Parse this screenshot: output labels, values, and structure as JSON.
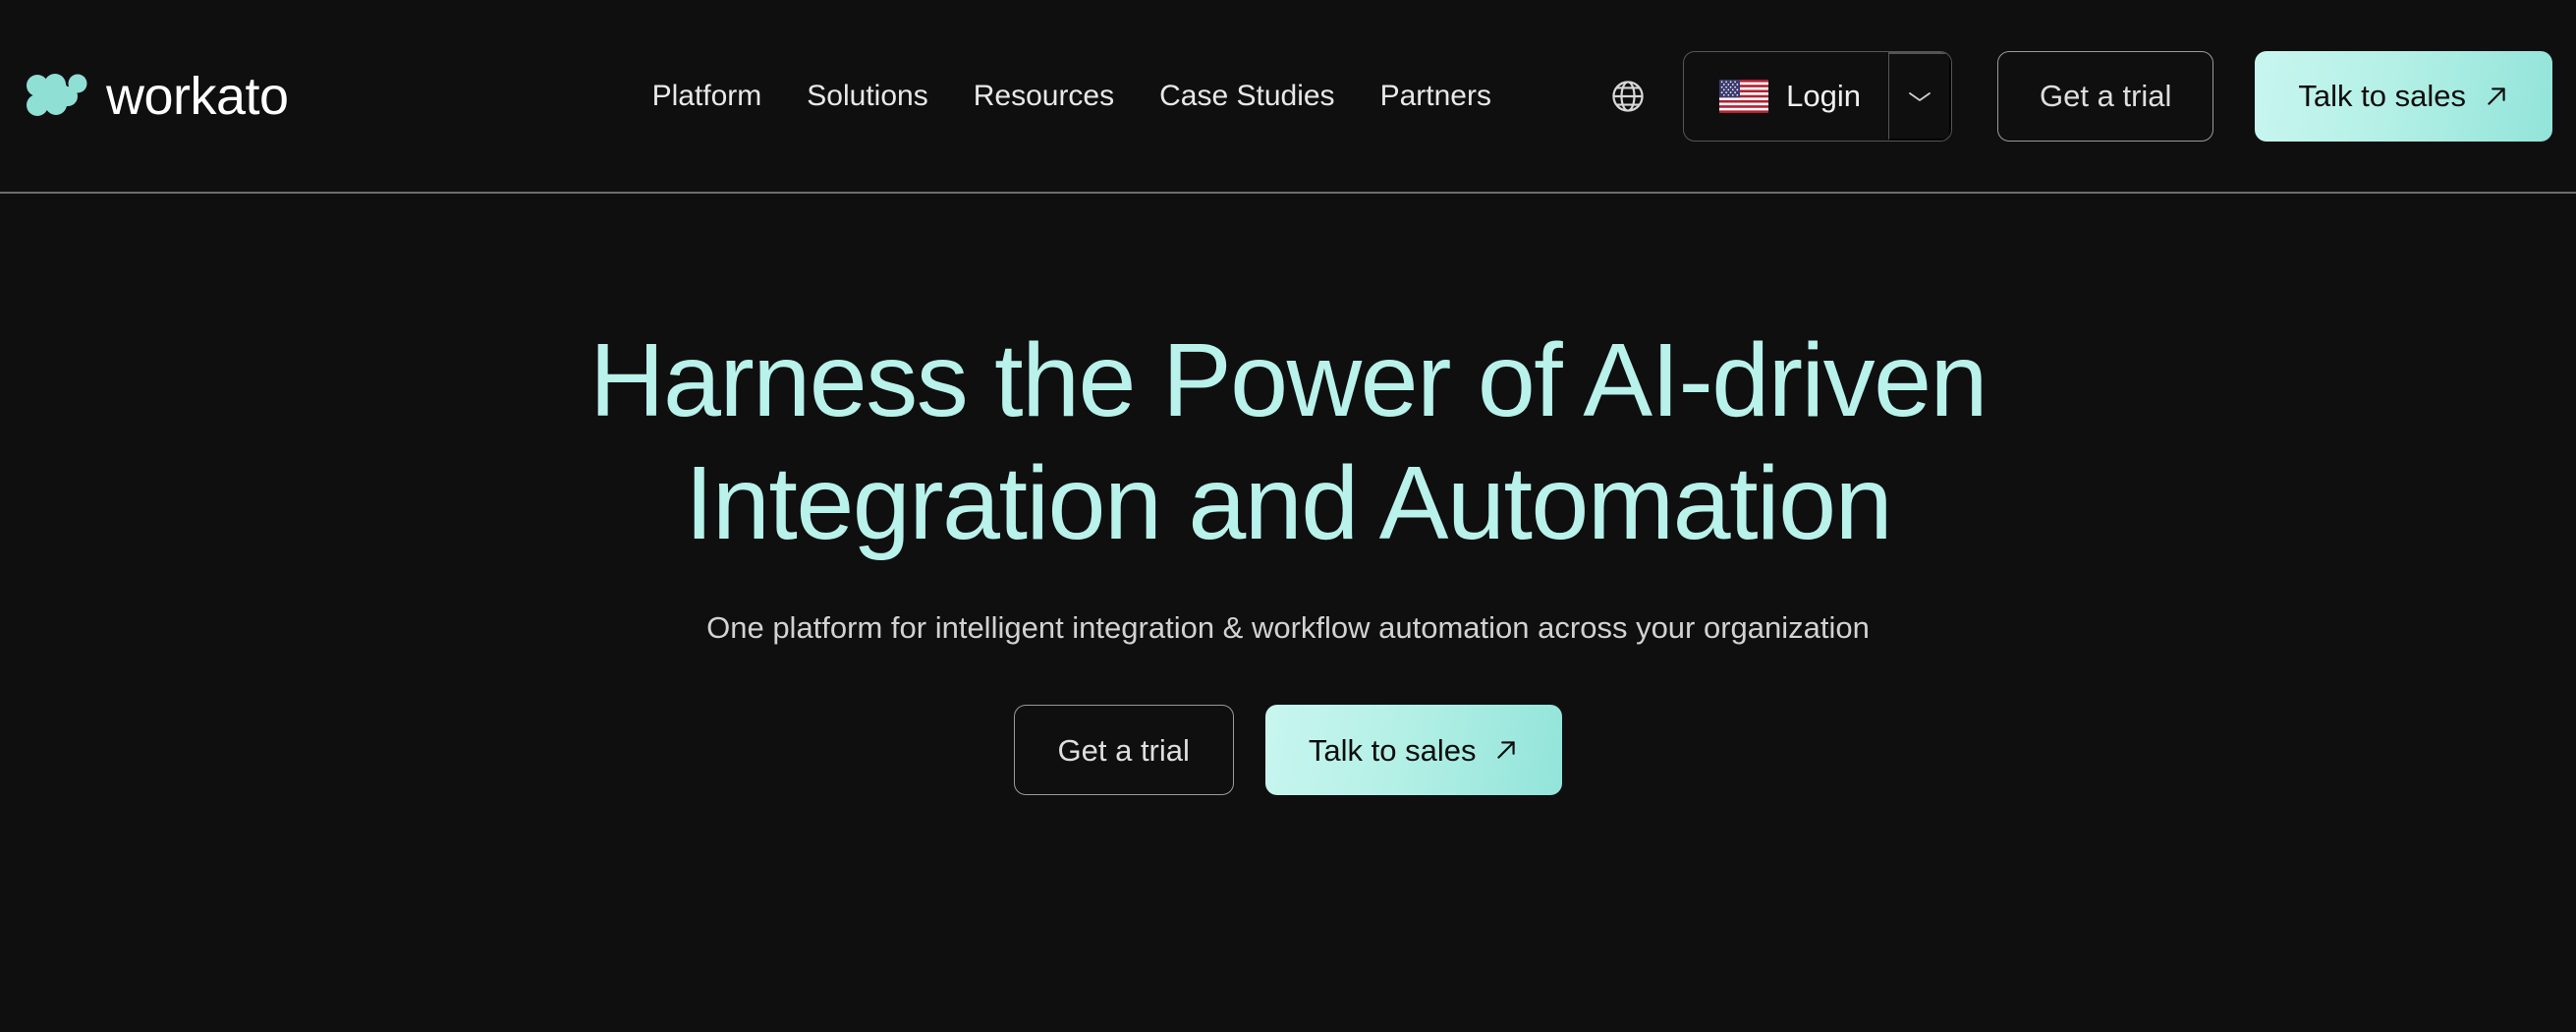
{
  "theme": {
    "background": "#0f0f10",
    "accent_mint": "#b8f2ea",
    "accent_mint_strong": "#8fe3da",
    "nav_text": "#e8e8e8",
    "body_text": "#d2d2d2",
    "border": "#8a8a8a"
  },
  "header": {
    "brand": {
      "word": "workato",
      "logo_icon": "workato-w-logo-icon"
    },
    "nav": [
      {
        "label": "Platform"
      },
      {
        "label": "Solutions"
      },
      {
        "label": "Resources"
      },
      {
        "label": "Case Studies"
      },
      {
        "label": "Partners"
      }
    ],
    "actions": {
      "globe_icon": "globe-icon",
      "login": {
        "label": "Login",
        "flag_icon": "us-flag-icon",
        "caret_icon": "chevron-down-icon"
      },
      "get_a_trial": "Get a trial",
      "talk_to_sales": "Talk to sales",
      "talk_to_sales_icon": "arrow-up-right-icon"
    }
  },
  "hero": {
    "title_line_1": "Harness the Power of AI-driven",
    "title_line_2": "Integration and Automation",
    "subtitle": "One platform for intelligent integration & workflow automation across your organization",
    "ctas": {
      "get_a_trial": "Get a trial",
      "talk_to_sales": "Talk to sales",
      "talk_to_sales_icon": "arrow-up-right-icon"
    }
  }
}
